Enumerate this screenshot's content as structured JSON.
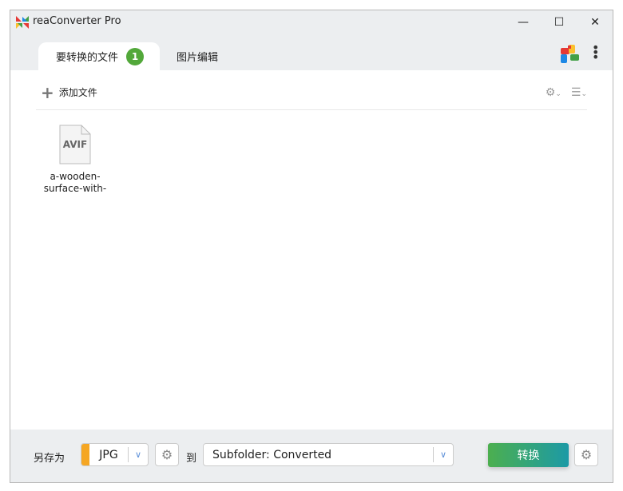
{
  "window": {
    "title": "reaConverter Pro",
    "minimize": "—",
    "maximize": "☐",
    "close": "✕"
  },
  "tabs": [
    {
      "label": "要转换的文件",
      "badge": "1"
    },
    {
      "label": "图片编辑"
    }
  ],
  "toolbar": {
    "add_files": "添加文件",
    "more": "⋮"
  },
  "files": [
    {
      "type": "AVIF",
      "name_line1": "a-wooden-",
      "name_line2": "surface-with-"
    }
  ],
  "bottom": {
    "save_as": "另存为",
    "format": "JPG",
    "to": "到",
    "destination": "Subfolder: Converted",
    "convert": "转换",
    "format_color": "#f5a623"
  }
}
